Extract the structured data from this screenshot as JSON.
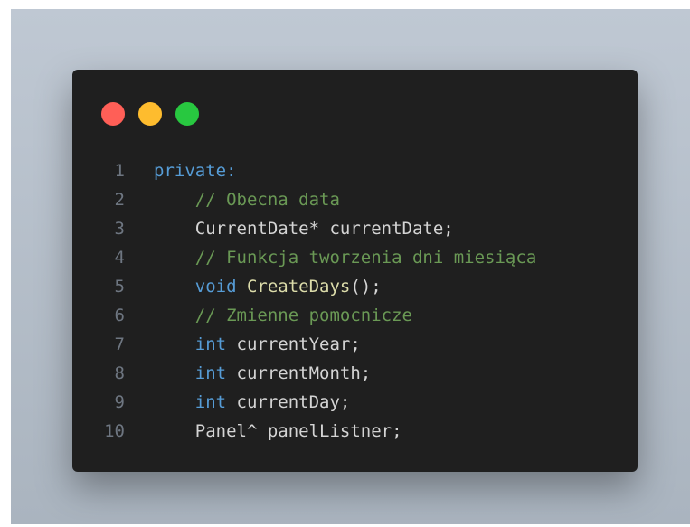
{
  "window": {
    "buttons": [
      {
        "name": "close",
        "color": "#ff5f57"
      },
      {
        "name": "minimize",
        "color": "#febc2e"
      },
      {
        "name": "maximize",
        "color": "#28c840"
      }
    ]
  },
  "colors": {
    "background": "#1f1f1f",
    "line_number": "#6e7681",
    "keyword": "#569cd6",
    "comment": "#6a9955",
    "function": "#dcdcaa",
    "text": "#d4d4d4"
  },
  "code": {
    "lines": [
      {
        "number": "1",
        "indent": "",
        "tokens": [
          {
            "text": "private:",
            "kind": "keyword"
          }
        ]
      },
      {
        "number": "2",
        "indent": "    ",
        "tokens": [
          {
            "text": "// Obecna data",
            "kind": "comment"
          }
        ]
      },
      {
        "number": "3",
        "indent": "    ",
        "tokens": [
          {
            "text": "CurrentDate* currentDate;",
            "kind": "text"
          }
        ]
      },
      {
        "number": "4",
        "indent": "    ",
        "tokens": [
          {
            "text": "// Funkcja tworzenia dni miesiąca",
            "kind": "comment"
          }
        ]
      },
      {
        "number": "5",
        "indent": "    ",
        "tokens": [
          {
            "text": "void",
            "kind": "keyword"
          },
          {
            "text": " ",
            "kind": "text"
          },
          {
            "text": "CreateDays",
            "kind": "function"
          },
          {
            "text": "();",
            "kind": "text"
          }
        ]
      },
      {
        "number": "6",
        "indent": "    ",
        "tokens": [
          {
            "text": "// Zmienne pomocnicze",
            "kind": "comment"
          }
        ]
      },
      {
        "number": "7",
        "indent": "    ",
        "tokens": [
          {
            "text": "int",
            "kind": "keyword"
          },
          {
            "text": " currentYear;",
            "kind": "text"
          }
        ]
      },
      {
        "number": "8",
        "indent": "    ",
        "tokens": [
          {
            "text": "int",
            "kind": "keyword"
          },
          {
            "text": " currentMonth;",
            "kind": "text"
          }
        ]
      },
      {
        "number": "9",
        "indent": "    ",
        "tokens": [
          {
            "text": "int",
            "kind": "keyword"
          },
          {
            "text": " currentDay;",
            "kind": "text"
          }
        ]
      },
      {
        "number": "10",
        "indent": "    ",
        "tokens": [
          {
            "text": "Panel^ panelListner;",
            "kind": "text"
          }
        ]
      }
    ]
  }
}
